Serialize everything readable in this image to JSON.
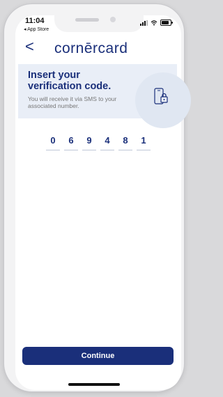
{
  "status": {
    "time": "11:04",
    "back_app": "◂ App Store"
  },
  "nav": {
    "back_label": "<",
    "logo": "cornērcard"
  },
  "banner": {
    "title": "Insert your verification code.",
    "subtitle": "You will receive it via SMS to your associated number."
  },
  "code": {
    "digits": [
      "0",
      "6",
      "9",
      "4",
      "8",
      "1"
    ]
  },
  "actions": {
    "continue_label": "Continue"
  },
  "colors": {
    "brand": "#1a2f7a",
    "banner_bg": "#e9eef7"
  },
  "icons": [
    "signal-icon",
    "wifi-icon",
    "battery-icon",
    "phone-lock-icon"
  ]
}
